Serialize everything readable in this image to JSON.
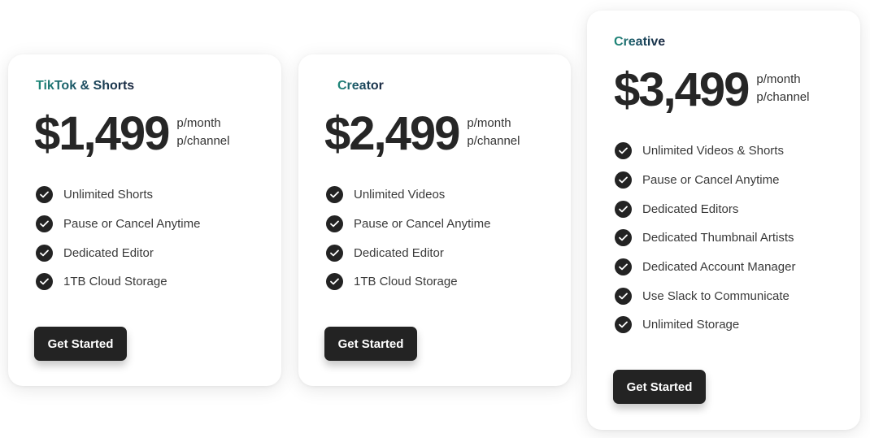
{
  "plans": [
    {
      "name": "TikTok & Shorts",
      "price": "$1,499",
      "per_line1": "p/month",
      "per_line2": "p/channel",
      "features": [
        "Unlimited Shorts",
        "Pause or Cancel Anytime",
        "Dedicated Editor",
        "1TB Cloud Storage"
      ],
      "cta": "Get Started"
    },
    {
      "name": "Creator",
      "price": "$2,499",
      "per_line1": "p/month",
      "per_line2": "p/channel",
      "features": [
        "Unlimited Videos",
        "Pause or Cancel Anytime",
        "Dedicated Editor",
        "1TB Cloud Storage"
      ],
      "cta": "Get Started"
    },
    {
      "name": "Creative",
      "price": "$3,499",
      "per_line1": "p/month",
      "per_line2": "p/channel",
      "features": [
        "Unlimited Videos & Shorts",
        "Pause or Cancel Anytime",
        "Dedicated Editors",
        "Dedicated Thumbnail Artists",
        "Dedicated Account Manager",
        "Use Slack to Communicate",
        "Unlimited Storage"
      ],
      "cta": "Get Started"
    }
  ],
  "icons": {
    "feature_bullet": "check-circle-icon"
  },
  "colors": {
    "button_bg": "#232323",
    "button_text": "#ffffff",
    "price_text": "#262626",
    "plan_name_gradient_start": "#1f8a7a",
    "plan_name_gradient_end": "#1a2740"
  }
}
